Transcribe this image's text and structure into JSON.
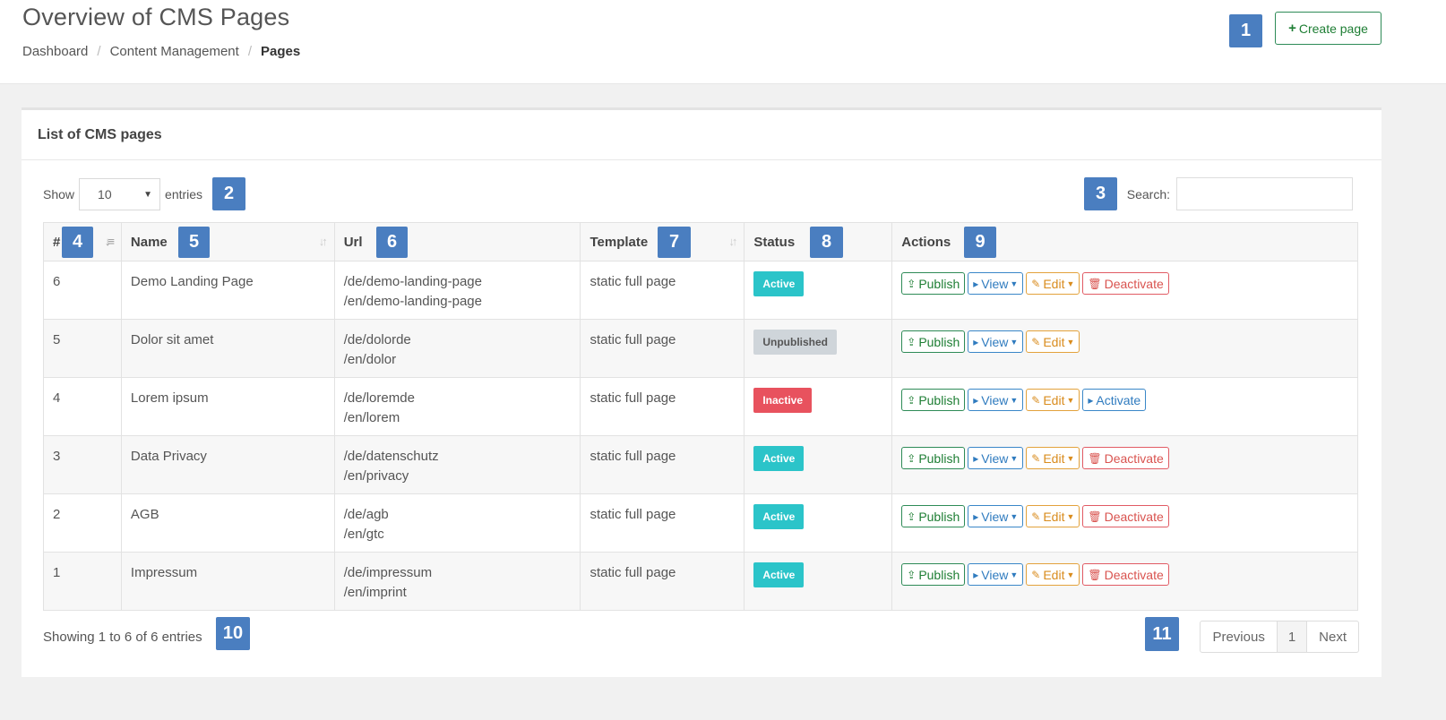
{
  "header": {
    "title": "Overview of CMS Pages",
    "breadcrumb": [
      "Dashboard",
      "Content Management",
      "Pages"
    ],
    "create_label": "Create page"
  },
  "callouts": [
    "1",
    "2",
    "3",
    "4",
    "5",
    "6",
    "7",
    "8",
    "9",
    "10",
    "11"
  ],
  "panel": {
    "title": "List of CMS pages",
    "show_label": "Show",
    "entries_label": "entries",
    "length_value": "10",
    "search_label": "Search:",
    "search_value": ""
  },
  "table": {
    "columns": [
      "#",
      "Name",
      "Url",
      "Template",
      "Status",
      "Actions"
    ],
    "rows": [
      {
        "id": "6",
        "name": "Demo Landing Page",
        "url1": "/de/demo-landing-page",
        "url2": "/en/demo-landing-page",
        "template": "static full page",
        "status": "Active",
        "status_color": "#2bc4c9",
        "actions": [
          "Publish",
          "View",
          "Edit",
          "Deactivate"
        ]
      },
      {
        "id": "5",
        "name": "Dolor sit amet",
        "url1": "/de/dolorde",
        "url2": "/en/dolor",
        "template": "static full page",
        "status": "Unpublished",
        "status_color": "#cfd5da",
        "actions": [
          "Publish",
          "View",
          "Edit"
        ]
      },
      {
        "id": "4",
        "name": "Lorem ipsum",
        "url1": "/de/loremde",
        "url2": "/en/lorem",
        "template": "static full page",
        "status": "Inactive",
        "status_color": "#e8525e",
        "actions": [
          "Publish",
          "View",
          "Edit",
          "Activate"
        ]
      },
      {
        "id": "3",
        "name": "Data Privacy",
        "url1": "/de/datenschutz",
        "url2": "/en/privacy",
        "template": "static full page",
        "status": "Active",
        "status_color": "#2bc4c9",
        "actions": [
          "Publish",
          "View",
          "Edit",
          "Deactivate"
        ]
      },
      {
        "id": "2",
        "name": "AGB",
        "url1": "/de/agb",
        "url2": "/en/gtc",
        "template": "static full page",
        "status": "Active",
        "status_color": "#2bc4c9",
        "actions": [
          "Publish",
          "View",
          "Edit",
          "Deactivate"
        ]
      },
      {
        "id": "1",
        "name": "Impressum",
        "url1": "/de/impressum",
        "url2": "/en/imprint",
        "template": "static full page",
        "status": "Active",
        "status_color": "#2bc4c9",
        "actions": [
          "Publish",
          "View",
          "Edit",
          "Deactivate"
        ]
      }
    ]
  },
  "footer": {
    "info": "Showing 1 to 6 of 6 entries",
    "prev": "Previous",
    "page": "1",
    "next": "Next"
  }
}
